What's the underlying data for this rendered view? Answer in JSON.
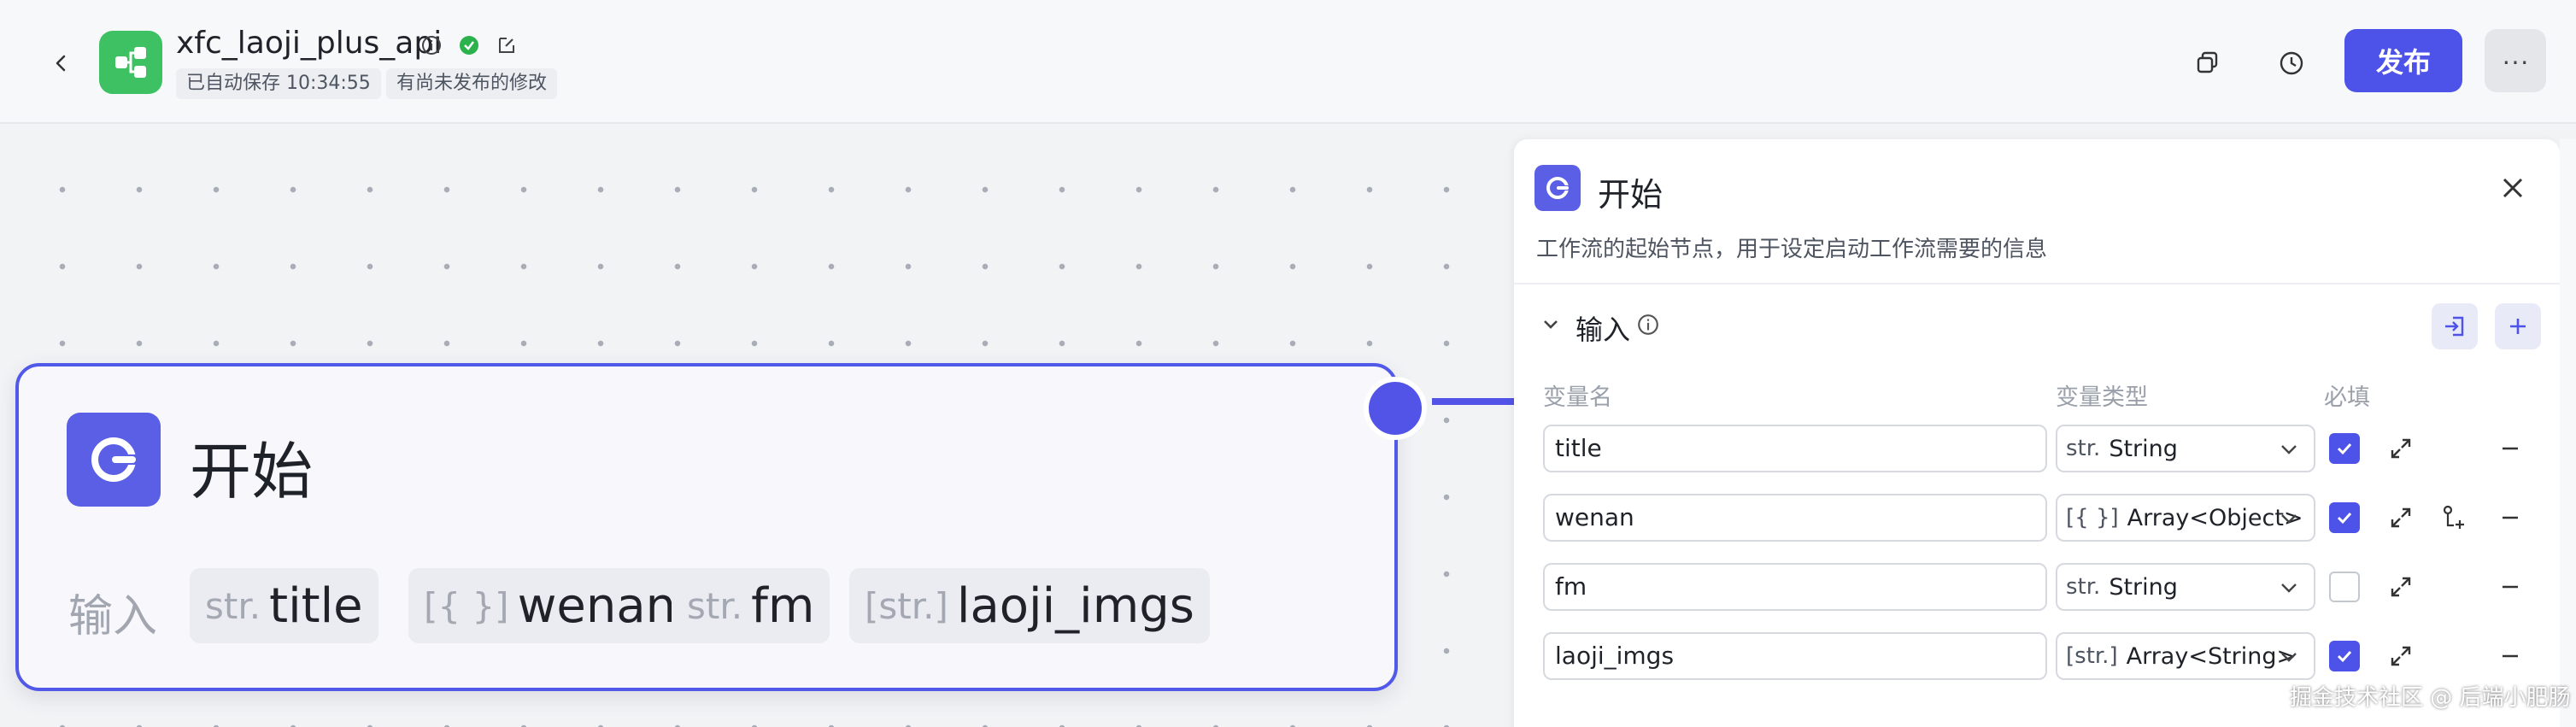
{
  "header": {
    "app_title": "xfc_laoji_plus_api",
    "autosave_label": "已自动保存 10:34:55",
    "unpublished_label": "有尚未发布的修改",
    "publish_label": "发布",
    "more_label": "···"
  },
  "node": {
    "title": "开始",
    "input_label": "输入",
    "variables": [
      {
        "type_prefix": "str.",
        "name": "title"
      },
      {
        "type_prefix": "[{ }]",
        "name": "wenan"
      },
      {
        "type_prefix": "str.",
        "name": "fm"
      },
      {
        "type_prefix": "[str.]",
        "name": "laoji_imgs"
      }
    ]
  },
  "panel": {
    "title": "开始",
    "description": "工作流的起始节点，用于设定启动工作流需要的信息",
    "section_title": "输入",
    "columns": {
      "name": "变量名",
      "type": "变量类型",
      "required": "必填"
    },
    "rows": [
      {
        "name": "title",
        "type_prefix": "str.",
        "type": "String",
        "required": true,
        "has_sub_add": false
      },
      {
        "name": "wenan",
        "type_prefix": "[{ }]",
        "type": "Array<Object>",
        "required": true,
        "has_sub_add": true
      },
      {
        "name": "fm",
        "type_prefix": "str.",
        "type": "String",
        "required": false,
        "has_sub_add": false
      },
      {
        "name": "laoji_imgs",
        "type_prefix": "[str.]",
        "type": "Array<String>",
        "required": true,
        "has_sub_add": false
      }
    ]
  },
  "watermark": "掘金技术社区 @ 后端小肥肠",
  "colors": {
    "accent": "#4d53e8",
    "logo_green": "#3ec162"
  }
}
